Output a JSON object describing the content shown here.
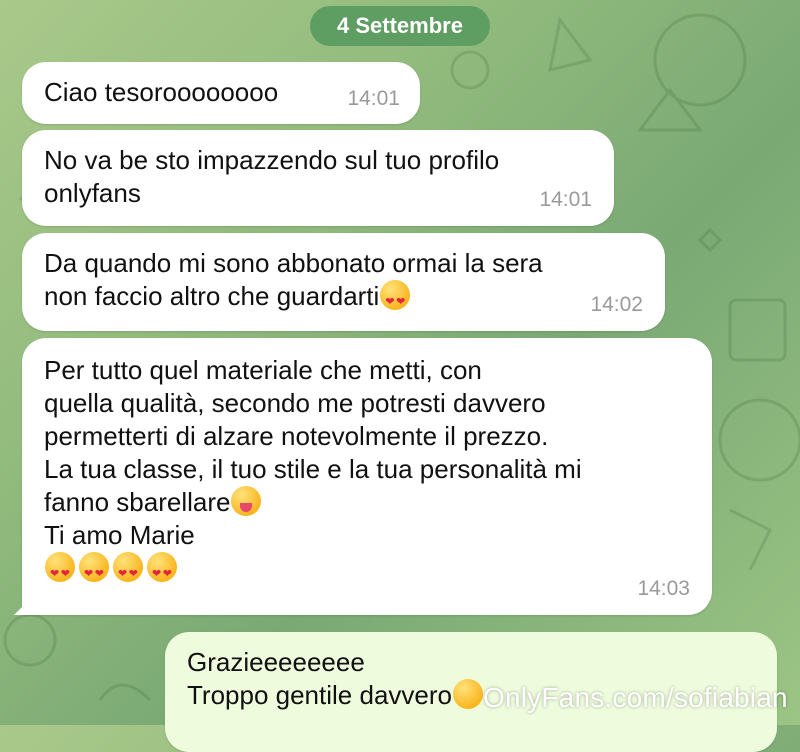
{
  "date_label": "4 Settembre",
  "messages": [
    {
      "text": "Ciao tesoroooooooo",
      "time": "14:01"
    },
    {
      "text": "No va be sto impazzendo sul tuo profilo\nonlyfans",
      "time": "14:01"
    },
    {
      "text_line1": "Da quando mi sono abbonato ormai la sera",
      "text_line2": "non faccio altro che guardarti",
      "emoji": "heart-eyes",
      "time": "14:02"
    },
    {
      "text_part1": "Per tutto quel materiale che metti, con\nquella qualità, secondo me potresti davvero\npermetterti di alzare notevolmente il prezzo.\nLa tua classe, il tuo stile e la tua personalità mi\nfanno sbarellare",
      "emoji_after_part1": "zany-face",
      "text_part2": "Ti amo Marie",
      "emoji_row": [
        "heart-eyes",
        "heart-eyes",
        "heart-eyes",
        "heart-eyes"
      ],
      "time": "14:03"
    }
  ],
  "sent_message": {
    "line1": "Grazieeeeeeee",
    "line2": "Troppo gentile davvero",
    "emoji": "grinning-face"
  },
  "watermark": "OnlyFans.com/sofiabian",
  "colors": {
    "date_pill": "#5f9e62",
    "incoming_bubble": "#ffffff",
    "outgoing_bubble": "#eefbdc"
  }
}
